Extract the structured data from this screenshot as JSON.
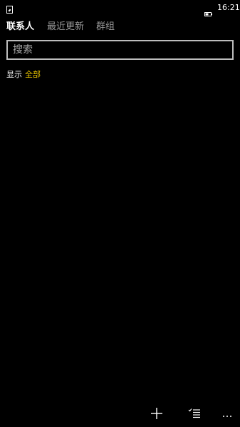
{
  "status_bar": {
    "time": "16:21",
    "left_icon": "notification-icon",
    "battery_icon": "battery-icon"
  },
  "tabs": [
    {
      "label": "联系人",
      "active": true
    },
    {
      "label": "最近更新",
      "active": false
    },
    {
      "label": "群组",
      "active": false
    }
  ],
  "search": {
    "placeholder": "搜索",
    "value": ""
  },
  "filter": {
    "label": "显示",
    "value": "全部"
  },
  "app_bar": {
    "buttons": [
      {
        "icon": "add-icon"
      },
      {
        "icon": "select-list-icon"
      },
      {
        "icon": "more-icon"
      }
    ]
  },
  "colors": {
    "background": "#000000",
    "accent": "#e8c400",
    "inactive_tab": "#9a9a9a",
    "search_border": "#bdbdbd"
  }
}
